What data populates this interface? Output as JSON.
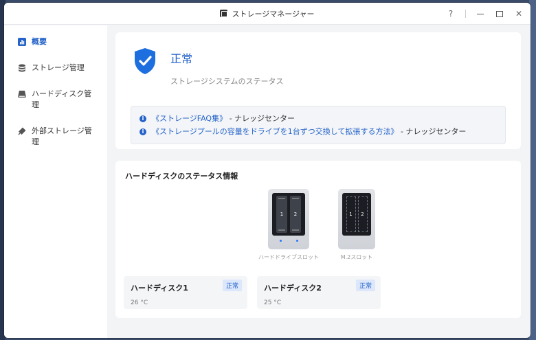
{
  "window": {
    "title": "ストレージマネージャー",
    "help": "?",
    "close": "✕"
  },
  "sidebar": {
    "items": [
      {
        "label": "概要",
        "active": true,
        "icon": "overview-chart-icon"
      },
      {
        "label": "ストレージ管理",
        "icon": "database-icon"
      },
      {
        "label": "ハードディスク管理",
        "icon": "hard-disk-icon"
      },
      {
        "label": "外部ストレージ管理",
        "icon": "usb-drive-icon"
      }
    ]
  },
  "status": {
    "title": "正常",
    "subtitle": "ストレージシステムのステータス",
    "links": [
      {
        "link": "《ストレージFAQ集》",
        "suffix": " - ナレッジセンター"
      },
      {
        "link": "《ストレージプールの容量をドライブを1台ずつ交換して拡張する方法》",
        "suffix": " - ナレッジセンター"
      }
    ]
  },
  "disk_status": {
    "title": "ハードディスクのステータス情報",
    "slots": [
      {
        "label": "ハードドライブスロット",
        "bays": [
          "1",
          "2"
        ]
      },
      {
        "label": "M.2スロット",
        "bays": [
          "1",
          "2"
        ]
      }
    ],
    "disks": [
      {
        "name": "ハードディスク1",
        "status": "正常",
        "temp": "26 °C"
      },
      {
        "name": "ハードディスク2",
        "status": "正常",
        "temp": "25 °C"
      }
    ]
  },
  "colors": {
    "accent": "#2563c9",
    "badge_bg": "#dce7fb",
    "content_bg": "#f3f4f6"
  }
}
